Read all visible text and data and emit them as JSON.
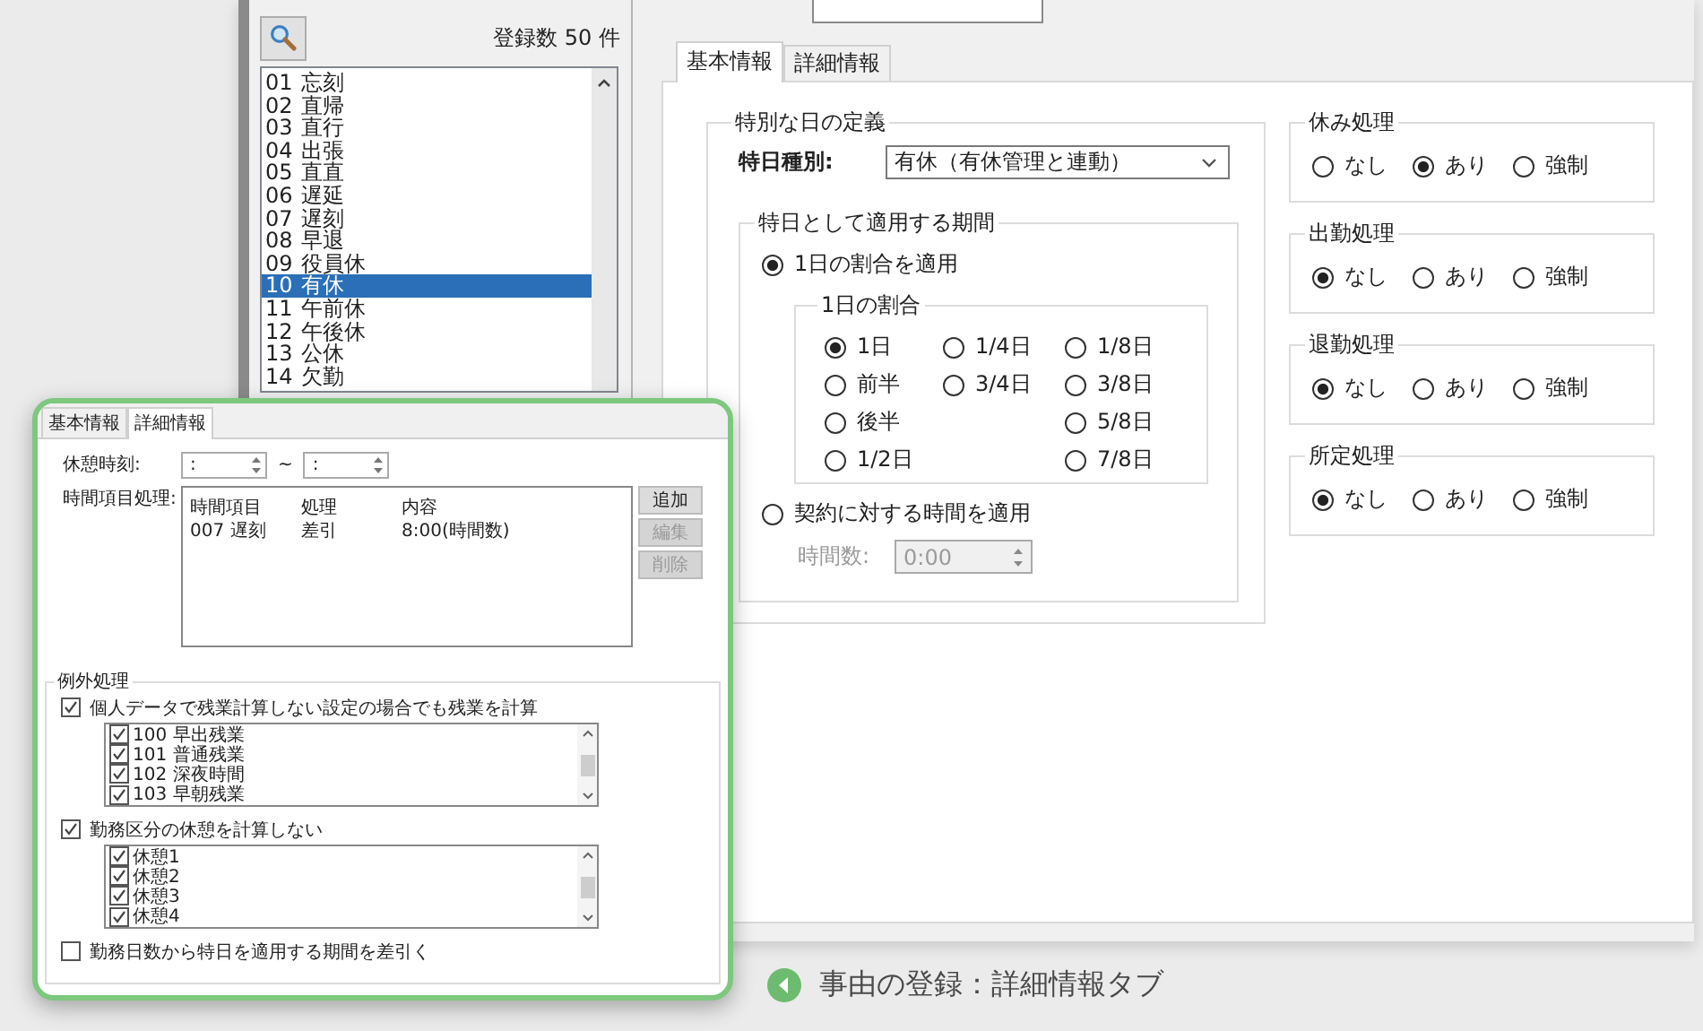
{
  "list_pane": {
    "count": "登録数 50 件",
    "items": [
      {
        "code": "01",
        "name": "忘刻",
        "selected": false
      },
      {
        "code": "02",
        "name": "直帰",
        "selected": false
      },
      {
        "code": "03",
        "name": "直行",
        "selected": false
      },
      {
        "code": "04",
        "name": "出張",
        "selected": false
      },
      {
        "code": "05",
        "name": "直直",
        "selected": false
      },
      {
        "code": "06",
        "name": "遅延",
        "selected": false
      },
      {
        "code": "07",
        "name": "遅刻",
        "selected": false
      },
      {
        "code": "08",
        "name": "早退",
        "selected": false
      },
      {
        "code": "09",
        "name": "役員休",
        "selected": false
      },
      {
        "code": "10",
        "name": "有休",
        "selected": true
      },
      {
        "code": "11",
        "name": "午前休",
        "selected": false
      },
      {
        "code": "12",
        "name": "午後休",
        "selected": false
      },
      {
        "code": "13",
        "name": "公休",
        "selected": false
      },
      {
        "code": "14",
        "name": "欠勤",
        "selected": false
      }
    ]
  },
  "tabs": [
    {
      "label": "基本情報",
      "selected": true
    },
    {
      "label": "詳細情報",
      "selected": false
    }
  ],
  "special_day": {
    "title": "特別な日の定義",
    "type_label": "特日種別:",
    "type_value": "有休（有休管理と連動）",
    "period": {
      "title": "特日として適用する期間",
      "options": [
        {
          "label": "1日の割合を適用",
          "selected": true
        },
        {
          "label": "契約に対する時間を適用",
          "selected": false
        }
      ],
      "ratio": {
        "title": "1日の割合",
        "columns": [
          [
            {
              "label": "1日",
              "selected": true
            },
            {
              "label": "前半",
              "selected": false
            },
            {
              "label": "後半",
              "selected": false
            },
            {
              "label": "1/2日",
              "selected": false
            }
          ],
          [
            {
              "label": "1/4日",
              "selected": false
            },
            {
              "label": "3/4日",
              "selected": false
            }
          ],
          [
            {
              "label": "1/8日",
              "selected": false
            },
            {
              "label": "3/8日",
              "selected": false
            },
            {
              "label": "5/8日",
              "selected": false
            },
            {
              "label": "7/8日",
              "selected": false
            }
          ]
        ]
      },
      "hours": {
        "label": "時間数:",
        "value": "0:00",
        "disabled": true
      }
    }
  },
  "processing": [
    {
      "title": "休み処理",
      "options": [
        {
          "label": "なし",
          "selected": false
        },
        {
          "label": "あり",
          "selected": true
        },
        {
          "label": "強制",
          "selected": false
        }
      ]
    },
    {
      "title": "出勤処理",
      "options": [
        {
          "label": "なし",
          "selected": true
        },
        {
          "label": "あり",
          "selected": false
        },
        {
          "label": "強制",
          "selected": false
        }
      ]
    },
    {
      "title": "退勤処理",
      "options": [
        {
          "label": "なし",
          "selected": true
        },
        {
          "label": "あり",
          "selected": false
        },
        {
          "label": "強制",
          "selected": false
        }
      ]
    },
    {
      "title": "所定処理",
      "options": [
        {
          "label": "なし",
          "selected": true
        },
        {
          "label": "あり",
          "selected": false
        },
        {
          "label": "強制",
          "selected": false
        }
      ]
    }
  ],
  "detail_window": {
    "tabs": [
      {
        "label": "基本情報",
        "selected": false
      },
      {
        "label": "詳細情報",
        "selected": true
      }
    ],
    "break_label": "休憩時刻:",
    "break_from": ":",
    "break_sep": "~",
    "break_to": ":",
    "items_label": "時間項目処理:",
    "items_columns": [
      "時間項目",
      "処理",
      "内容"
    ],
    "items_rows": [
      [
        "007 遅刻",
        "差引",
        "8:00(時間数)"
      ]
    ],
    "buttons": [
      {
        "label": "追加",
        "disabled": false
      },
      {
        "label": "編集",
        "disabled": true
      },
      {
        "label": "削除",
        "disabled": true
      }
    ],
    "exceptions": {
      "title": "例外処理",
      "sections": [
        {
          "label": "個人データで残業計算しない設定の場合でも残業を計算",
          "checked": true,
          "items": [
            {
              "label": "100 早出残業",
              "checked": true
            },
            {
              "label": "101 普通残業",
              "checked": true
            },
            {
              "label": "102 深夜時間",
              "checked": true
            },
            {
              "label": "103 早朝残業",
              "checked": true
            }
          ]
        },
        {
          "label": "勤務区分の休憩を計算しない",
          "checked": true,
          "items": [
            {
              "label": "休憩1",
              "checked": true
            },
            {
              "label": "休憩2",
              "checked": true
            },
            {
              "label": "休憩3",
              "checked": true
            },
            {
              "label": "休憩4",
              "checked": true
            }
          ]
        }
      ],
      "last": {
        "label": "勤務日数から特日を適用する期間を差引く",
        "checked": false
      }
    }
  },
  "caption": "事由の登録：詳細情報タブ"
}
